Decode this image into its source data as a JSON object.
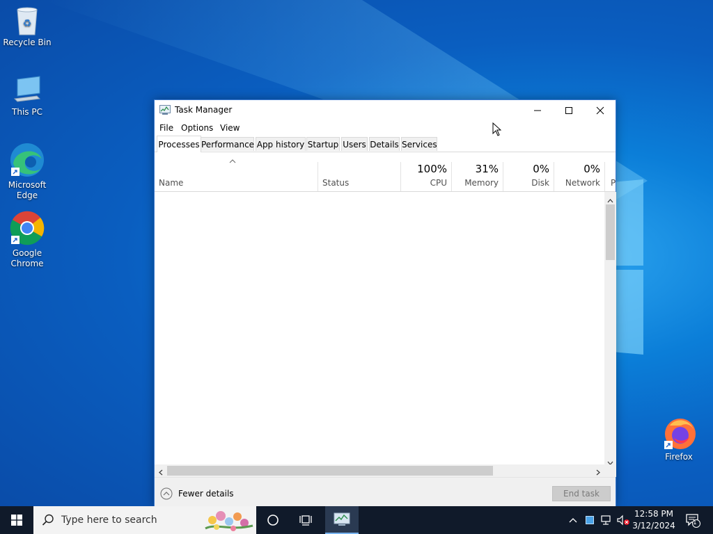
{
  "desktop": {
    "icons": [
      {
        "label": "Recycle Bin"
      },
      {
        "label": "This PC"
      },
      {
        "label": "Microsoft Edge"
      },
      {
        "label": "Google Chrome"
      },
      {
        "label": "Firefox"
      }
    ]
  },
  "window": {
    "title": "Task Manager",
    "menu": [
      "File",
      "Options",
      "View"
    ],
    "tabs": [
      "Processes",
      "Performance",
      "App history",
      "Startup",
      "Users",
      "Details",
      "Services"
    ],
    "active_tab": "Processes",
    "columns": {
      "name": {
        "label": "Name"
      },
      "status": {
        "label": "Status"
      },
      "cpu": {
        "value": "100%",
        "label": "CPU"
      },
      "memory": {
        "value": "31%",
        "label": "Memory"
      },
      "disk": {
        "value": "0%",
        "label": "Disk"
      },
      "network": {
        "value": "0%",
        "label": "Network"
      },
      "power": {
        "label": "P"
      }
    },
    "footer": {
      "fewer_details": "Fewer details",
      "end_task": "End task"
    }
  },
  "taskbar": {
    "search_placeholder": "Type here to search",
    "time": "12:58 PM",
    "date": "3/12/2024",
    "notification_count": "1"
  },
  "colors": {
    "accent": "#0078d7",
    "taskbar": "#101a2a"
  }
}
